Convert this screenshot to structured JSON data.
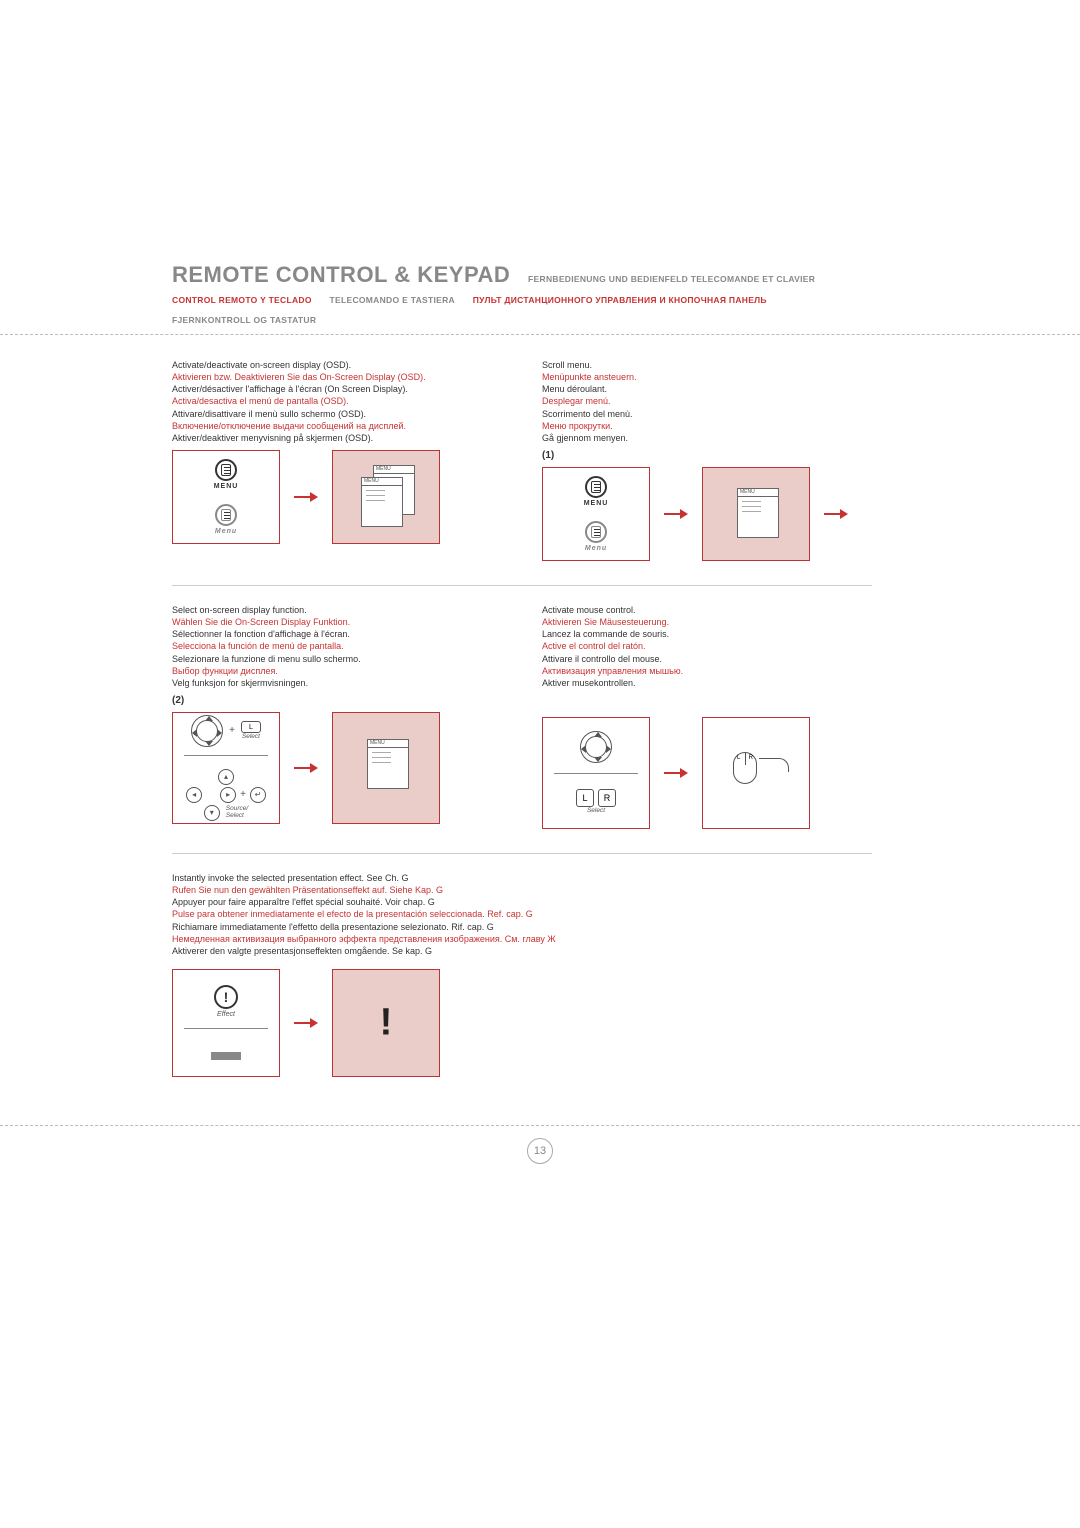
{
  "header": {
    "main_title": "REMOTE CONTROL & KEYPAD",
    "suffix_gray": "FERNBEDIENUNG UND BEDIENFELD   TELECOMANDE ET CLAVIER",
    "line2_red_a": "CONTROL REMOTO Y TECLADO",
    "line2_gray": "TELECOMANDO E TASTIERA",
    "line2_red_b": "ПУЛЬТ ДИСТАНЦИОННОГО УПРАВЛЕНИЯ И КНОПОЧНАЯ ПАНЕЛЬ",
    "line3_gray": "FJERNKONTROLL OG TASTATUR"
  },
  "block_activate": {
    "l1": "Activate/deactivate on-screen display (OSD).",
    "l2": "Aktivieren bzw. Deaktivieren Sie das On-Screen Display (OSD).",
    "l3": "Activer/désactiver l'affichage à l'écran (On Screen Display).",
    "l4": "Activa/desactiva el menú de pantalla (OSD).",
    "l5": "Attivare/disattivare il menù sullo schermo (OSD).",
    "l6": "Включение/отключение выдачи сообщений на дисплей.",
    "l7": "Aktiver/deaktiver menyvisning på skjermen (OSD)."
  },
  "block_scroll": {
    "l1": "Scroll menu.",
    "l2": "Menüpunkte ansteuern.",
    "l3": "Menu déroulant.",
    "l4": "Desplegar menú.",
    "l5": "Scorrimento del menù.",
    "l6": "Меню прокрутки.",
    "l7": "Gå gjennom menyen.",
    "marker": "(1)"
  },
  "block_select": {
    "l1": "Select on-screen display function.",
    "l2": "Wählen Sie die On-Screen Display Funktion.",
    "l3": "Sélectionner la fonction d'affichage à l'écran.",
    "l4": "Selecciona la función de menú de pantalla.",
    "l5": "Selezionare la funzione di menu sullo schermo.",
    "l6": "Выбор функции дисплея.",
    "l7": "Velg funksjon for skjermvisningen.",
    "marker": "(2)"
  },
  "block_mouse": {
    "l1": "Activate mouse control.",
    "l2": "Aktivieren Sie Mäusesteuerung.",
    "l3": "Lancez la commande de souris.",
    "l4": "Active el control del ratón.",
    "l5": "Attivare il controllo del mouse.",
    "l6": "Активизация управления мышью.",
    "l7": "Aktiver musekontrollen."
  },
  "block_effect": {
    "l1": "Instantly invoke the selected presentation effect. See Ch. G",
    "l2": "Rufen Sie nun den gewählten Präsentationseffekt auf. Siehe Kap. G",
    "l3": "Appuyer pour faire apparaître l'effet spécial souhaité. Voir chap. G",
    "l4": "Pulse para obtener inmediatamente el efecto de la presentación seleccionada. Ref. cap. G",
    "l5": "Richiamare immediatamente l'effetto della presentazione selezionato. Rif. cap. G",
    "l6": "Немедленная активизация выбранного эффекта представления изображения. См. главу Ж",
    "l7": "Aktiverer den valgte presentasjonseffekten omgående. Se kap. G"
  },
  "labels": {
    "menu_upper": "MENU",
    "menu_lower": "Menu",
    "select": "Select",
    "source_select": "Source/\nSelect",
    "L": "L",
    "R": "R",
    "effect": "Effect",
    "bang": "!",
    "menu_small": "MENU"
  },
  "page_number": "13"
}
